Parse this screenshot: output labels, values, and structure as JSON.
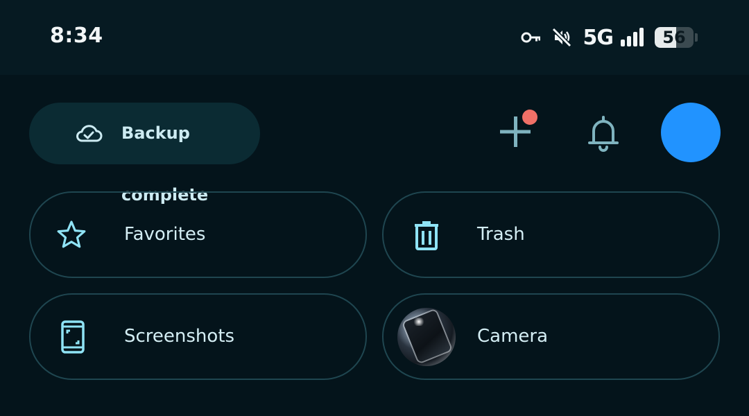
{
  "status_bar": {
    "time": "8:34",
    "icons": [
      "vpn-key-icon",
      "mute-icon",
      "signal-icon"
    ],
    "network": "5G",
    "battery_level": "56",
    "battery_fraction": 0.56
  },
  "header": {
    "backup_label": "Backup complete",
    "backup_icon": "cloud-check-icon",
    "add_icon": "plus-icon",
    "notification_icon": "bell-icon",
    "badge_color": "#f07067",
    "avatar_color": "#2193ff"
  },
  "collections": [
    {
      "label": "Favorites",
      "icon": "star-icon"
    },
    {
      "label": "Trash",
      "icon": "trash-icon"
    },
    {
      "label": "Screenshots",
      "icon": "phone-screenshot-icon"
    },
    {
      "label": "Camera",
      "icon": "camera-thumbnail"
    }
  ],
  "colors": {
    "background": "#04141b",
    "chip": "#0b2b33",
    "accent": "#8fe3f5",
    "tile_border": "#1f4650"
  }
}
